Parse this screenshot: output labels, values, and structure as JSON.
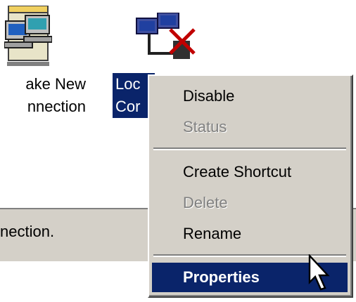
{
  "desktop": {
    "icons": [
      {
        "label_line1": "ake New",
        "label_line2": "nnection",
        "icon": "network-wizard-icon"
      },
      {
        "label_line1": "Loc",
        "label_line2": "Cor",
        "icon": "local-area-connection-disabled-icon",
        "selected": true
      }
    ]
  },
  "status_bar": {
    "text": "nection."
  },
  "context_menu": {
    "items": [
      {
        "label": "Disable",
        "enabled": true
      },
      {
        "label": "Status",
        "enabled": false
      },
      {
        "label": "Create Shortcut",
        "enabled": true
      },
      {
        "label": "Delete",
        "enabled": false
      },
      {
        "label": "Rename",
        "enabled": true
      },
      {
        "label": "Properties",
        "enabled": true,
        "highlighted": true,
        "default": true
      }
    ]
  },
  "colors": {
    "selection": "#0a246a",
    "menu_background": "#d4d0c8",
    "disabled_text": "#808080"
  },
  "cursor": {
    "icon": "arrow-pointer-icon"
  }
}
